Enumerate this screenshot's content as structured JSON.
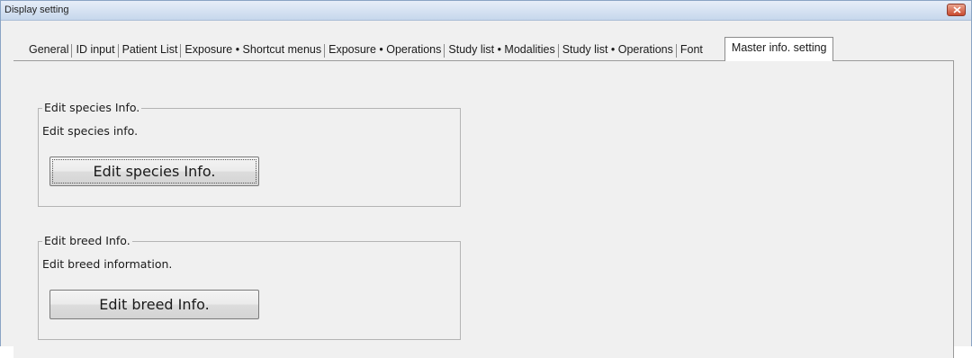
{
  "window": {
    "title": "Display setting"
  },
  "tabs": [
    {
      "label": "General"
    },
    {
      "label": "ID input"
    },
    {
      "label": "Patient List"
    },
    {
      "label": "Exposure • Shortcut menus"
    },
    {
      "label": "Exposure • Operations"
    },
    {
      "label": "Study list • Modalities"
    },
    {
      "label": "Study list • Operations"
    },
    {
      "label": "Font"
    },
    {
      "label": "Master info. setting",
      "active": true
    }
  ],
  "groups": {
    "species": {
      "legend": "Edit species Info.",
      "description": "Edit species info.",
      "button_label": "Edit species Info."
    },
    "breed": {
      "legend": "Edit breed Info.",
      "description": "Edit breed information.",
      "button_label": "Edit breed Info."
    }
  },
  "icons": {
    "close": "close-icon"
  },
  "colors": {
    "close_button": "#c94a2f",
    "titlebar": "#c6d7ec"
  }
}
